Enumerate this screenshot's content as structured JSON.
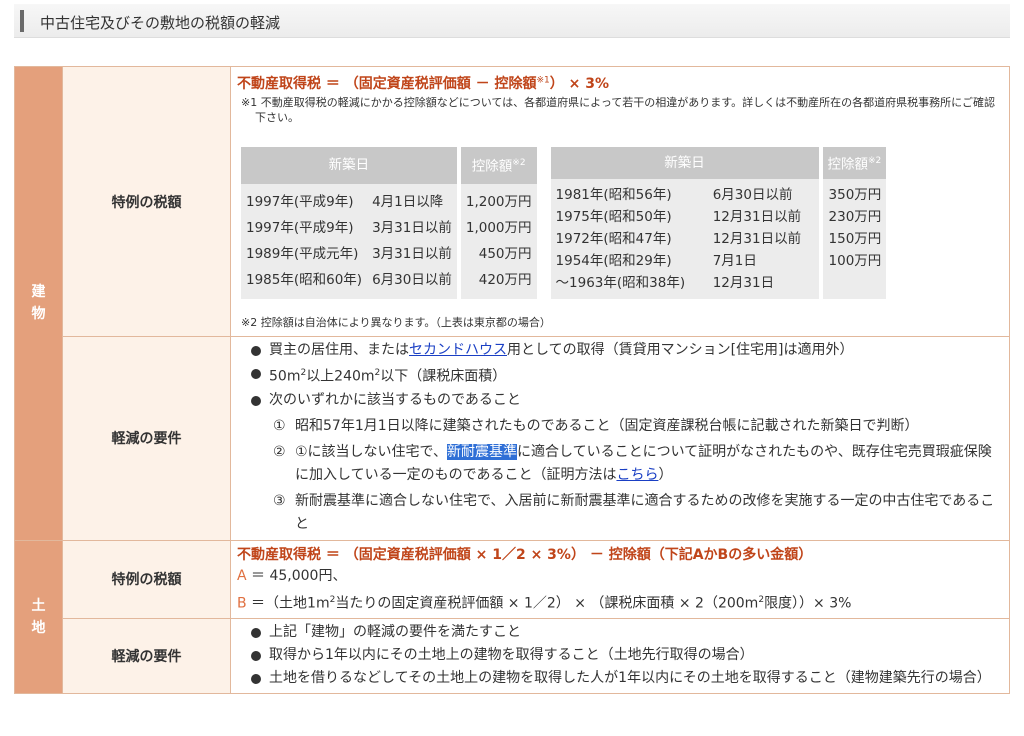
{
  "page_title": "中古住宅及びその敷地の税額の軽減",
  "building": {
    "category": "建物",
    "special": {
      "label": "特例の税額",
      "formula_pre": "不動産取得税 ＝ （固定資産税評価額 － 控除額",
      "formula_sup": "※1",
      "formula_post": "） × 3%",
      "note1_mark": "※1",
      "note1_text": "不動産取得税の軽減にかかる控除額などについては、各都道府県によって若干の相違があります。詳しくは不動産所在の各都道府県税事務所にご確認下さい。",
      "table_header_date": "新築日",
      "table_header_deduction": "控除額",
      "table_header_sup": "※2",
      "table_left": [
        {
          "year": "1997年(平成9年)",
          "date": "4月1日以降",
          "amount": "1,200万円"
        },
        {
          "year": "1997年(平成9年)",
          "date": "3月31日以前",
          "amount": "1,000万円"
        },
        {
          "year": "1989年(平成元年)",
          "date": "3月31日以前",
          "amount": "450万円"
        },
        {
          "year": "1985年(昭和60年)",
          "date": "6月30日以前",
          "amount": "420万円"
        }
      ],
      "table_right": [
        {
          "year": "1981年(昭和56年)",
          "date": "6月30日以前",
          "amount": "350万円"
        },
        {
          "year": "1975年(昭和50年)",
          "date": "12月31日以前",
          "amount": "230万円"
        },
        {
          "year": "1972年(昭和47年)",
          "date": "12月31日以前",
          "amount": "150万円"
        },
        {
          "year": "1954年(昭和29年)",
          "date": "7月1日",
          "amount": "100万円"
        },
        {
          "year": "〜1963年(昭和38年)",
          "date": "12月31日",
          "amount": ""
        }
      ],
      "note2": "※2 控除額は自治体により異なります。（上表は東京都の場合）"
    },
    "requirements": {
      "label": "軽減の要件",
      "item1_pre": "買主の居住用、または",
      "item1_link": "セカンドハウス",
      "item1_post": "用としての取得（賃貸用マンション[住宅用]は適用外）",
      "item2_a": "50m",
      "item2_b": "以上240m",
      "item2_c": "以下（課税床面積）",
      "item2_sup": "2",
      "item3": "次のいずれかに該当するものであること",
      "sub1_num": "①",
      "sub1_text": "昭和57年1月1日以降に建築されたものであること（固定資産課税台帳に記載された新築日で判断）",
      "sub2_num": "②",
      "sub2_pre": "①に該当しない住宅で、",
      "sub2_hl": "新耐震基準",
      "sub2_mid": "に適合していることについて証明がなされたものや、既存住宅売買瑕疵保険に加入している一定のものであること（証明方法は",
      "sub2_link": "こちら",
      "sub2_post": "）",
      "sub3_num": "③",
      "sub3_text": "新耐震基準に適合しない住宅で、入居前に新耐震基準に適合するための改修を実施する一定の中古住宅であること"
    }
  },
  "land": {
    "category": "土地",
    "special": {
      "label": "特例の税額",
      "formula": "不動産取得税 ＝ （固定資産税評価額 × 1／2 × 3%） － 控除額（下記AかBの多い金額）",
      "a_label": "A",
      "a_text": " ＝ 45,000円、",
      "b_label": "B",
      "b_pre": " ＝（土地1m",
      "b_mid": "当たりの固定資産税評価額 × 1／2） × （課税床面積 × 2（200m",
      "b_post": "限度））× 3%",
      "sup2": "2"
    },
    "requirements": {
      "label": "軽減の要件",
      "items": [
        "上記「建物」の軽減の要件を満たすこと",
        "取得から1年以内にその土地上の建物を取得すること（土地先行取得の場合）",
        "土地を借りるなどしてその土地上の建物を取得した人が1年以内にその土地を取得すること（建物建築先行の場合）"
      ]
    }
  },
  "colors": {
    "category_bg": "#e4a07c",
    "label_bg": "#fdf2e8",
    "formula": "#c0451a",
    "link": "#1a3fc4",
    "highlight": "#2f6fd6"
  }
}
